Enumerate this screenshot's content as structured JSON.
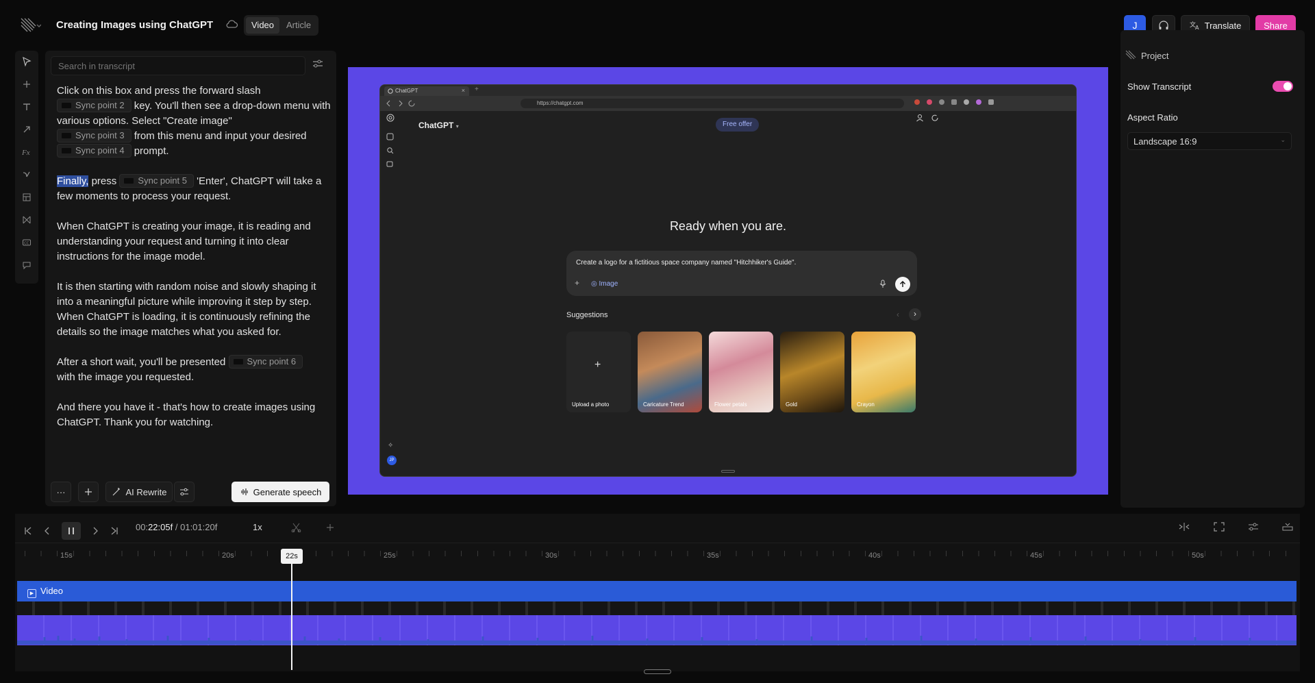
{
  "header": {
    "title": "Creating Images using ChatGPT",
    "tabs": [
      {
        "label": "Video",
        "active": true
      },
      {
        "label": "Article",
        "active": false
      }
    ]
  },
  "rail": {
    "icons": [
      "pointer-icon",
      "plus-icon",
      "text-icon",
      "arrow-icon",
      "effects-icon",
      "pen-icon",
      "layout-icon",
      "transition-icon",
      "captions-icon",
      "comment-icon"
    ]
  },
  "transcript": {
    "search_placeholder": "Search in transcript",
    "p1_a": "Click on this box and press the forward slash",
    "chip2": "Sync point 2",
    "p1_b": " key. You'll then see a drop-down menu with various options. Select \"Create image\"",
    "chip3": "Sync point 3",
    "p1_c": " from this menu and input your desired",
    "chip4": "Sync point 4",
    "p1_d": " prompt.",
    "p2_hl": "Finally,",
    "p2_a": " press ",
    "chip5": "Sync point 5",
    "p2_b": " 'Enter', ChatGPT will take a few moments to process your request.",
    "p3": "When ChatGPT is creating your image, it is reading and understanding your request and turning it into clear instructions for the image model.",
    "p4": "It is then starting with random noise and slowly shaping it into a meaningful picture while improving it step by step. When ChatGPT is loading, it is continuously refining the details so the image matches what you asked for.",
    "p5_a": "After a short wait, you'll be presented ",
    "chip6": "Sync point 6",
    "p5_b": " with the image you requested.",
    "p6": "And there you have it - that's how to create images using ChatGPT. Thank you for watching.",
    "more_label": "···",
    "ai_rewrite": "AI Rewrite",
    "generate": "Generate speech"
  },
  "preview": {
    "tab_title": "ChatGPT",
    "url": "https://chatgpt.com",
    "app_name": "ChatGPT",
    "free_offer": "Free offer",
    "headline": "Ready when you are.",
    "prompt": "Create a logo for a fictitious space company named \"Hitchhiker's Guide\".",
    "image_chip": "Image",
    "suggestions_label": "Suggestions",
    "cards": [
      "Upload a photo",
      "Caricature Trend",
      "Flower petals",
      "Gold",
      "Crayon"
    ],
    "avatar": "JP"
  },
  "right": {
    "user_initial": "J",
    "translate": "Translate",
    "share": "Share",
    "project": "Project",
    "show_transcript": "Show Transcript",
    "show_transcript_on": true,
    "aspect_ratio_label": "Aspect Ratio",
    "aspect_ratio_value": "Landscape 16:9"
  },
  "timeline": {
    "current_a": "00:",
    "current_b": "22:05f",
    "separator": "/",
    "total": "01:01:20f",
    "speed": "1x",
    "playhead": "22s",
    "ticks": [
      "15s",
      "20s",
      "25s",
      "30s",
      "35s",
      "40s",
      "45s",
      "50s"
    ],
    "track_label": "Video"
  },
  "colors": {
    "accent": "#5b47e6",
    "track": "#2a5bd7",
    "share": "#e23ba6",
    "toggle": "#e94cb0"
  }
}
